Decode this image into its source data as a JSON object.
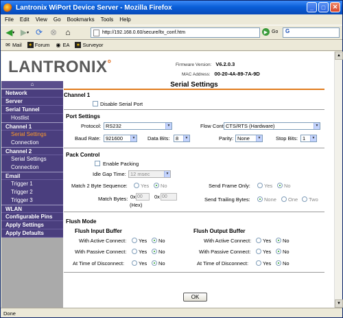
{
  "window": {
    "title": "Lantronix WiPort Device Server - Mozilla Firefox"
  },
  "menu": [
    "File",
    "Edit",
    "View",
    "Go",
    "Bookmarks",
    "Tools",
    "Help"
  ],
  "toolbar": {
    "url": "http://192.168.0.60/secure/ltx_conf.htm",
    "go_label": "Go",
    "search_text": "G"
  },
  "bookmarks": [
    "Mail",
    "Forum",
    "EA",
    "Surveyor"
  ],
  "header": {
    "logo": "LANTRONIX",
    "firmware_label": "Firmware Version:",
    "firmware_value": "V6.2.0.3",
    "mac_label": "MAC Address:",
    "mac_value": "00-20-4A-89-7A-9D"
  },
  "nav": {
    "items": [
      {
        "label": "Network",
        "level": "top"
      },
      {
        "label": "Server",
        "level": "top"
      },
      {
        "label": "Serial Tunnel",
        "level": "top"
      },
      {
        "label": "Hostlist",
        "level": "sub"
      },
      {
        "label": "Channel 1",
        "level": "top"
      },
      {
        "label": "Serial Settings",
        "level": "sub",
        "active": true
      },
      {
        "label": "Connection",
        "level": "sub"
      },
      {
        "label": "Channel 2",
        "level": "top"
      },
      {
        "label": "Serial Settings",
        "level": "sub"
      },
      {
        "label": "Connection",
        "level": "sub"
      },
      {
        "label": "Email",
        "level": "top"
      },
      {
        "label": "Trigger 1",
        "level": "sub"
      },
      {
        "label": "Trigger 2",
        "level": "sub"
      },
      {
        "label": "Trigger 3",
        "level": "sub"
      },
      {
        "label": "WLAN",
        "level": "top"
      },
      {
        "label": "Configurable Pins",
        "level": "top"
      },
      {
        "label": "Apply Settings",
        "level": "top"
      },
      {
        "label": "Apply Defaults",
        "level": "top"
      }
    ]
  },
  "form": {
    "page_title": "Serial Settings",
    "channel_title": "Channel 1",
    "disable_serial_port": "Disable Serial Port",
    "port_settings": "Port Settings",
    "protocol_label": "Protocol:",
    "protocol_value": "RS232",
    "flow_label": "Flow Control:",
    "flow_value": "CTS/RTS (Hardware)",
    "baud_label": "Baud Rate:",
    "baud_value": "921600",
    "databits_label": "Data Bits:",
    "databits_value": "8",
    "parity_label": "Parity:",
    "parity_value": "None",
    "stopbits_label": "Stop Bits:",
    "stopbits_value": "1",
    "pack_control": "Pack Control",
    "enable_packing": "Enable Packing",
    "idle_gap_label": "Idle Gap Time:",
    "idle_gap_value": "12 msec",
    "match2_label": "Match 2 Byte Sequence:",
    "yes": "Yes",
    "no": "No",
    "none": "None",
    "one": "One",
    "two": "Two",
    "send_frame_label": "Send Frame Only:",
    "match_bytes_label": "Match Bytes:",
    "match_prefix": "0x",
    "match_value": "00",
    "hex": "(Hex)",
    "send_trailing_label": "Send Trailing Bytes:",
    "flush_mode": "Flush Mode",
    "flush_input": "Flush Input Buffer",
    "flush_output": "Flush Output Buffer",
    "active_label": "With Active Connect:",
    "passive_label": "With Passive Connect:",
    "disconnect_label": "At Time of Disconnect:",
    "ok": "OK"
  },
  "status": "Done"
}
